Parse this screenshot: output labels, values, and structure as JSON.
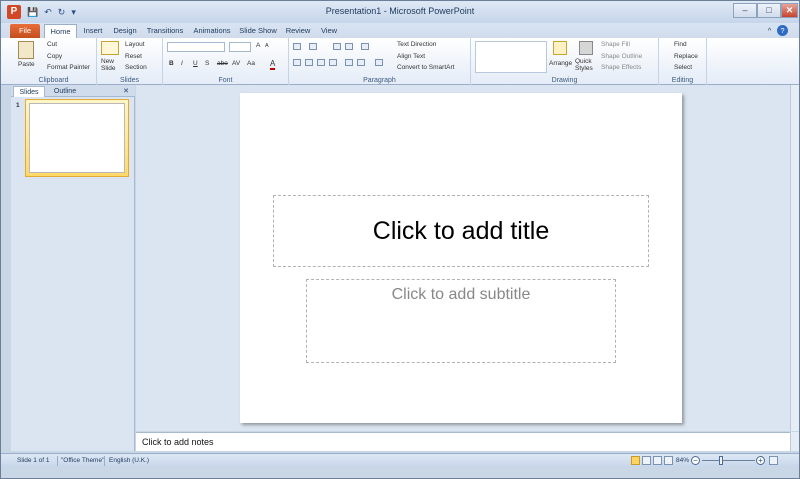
{
  "window": {
    "title": "Presentation1 - Microsoft PowerPoint",
    "min": "–",
    "max": "□",
    "close": "✕"
  },
  "qat": {
    "logo": "P",
    "save": "💾",
    "undo": "↶",
    "redo": "↻",
    "customize": "▾"
  },
  "tabs": [
    "File",
    "Home",
    "Insert",
    "Design",
    "Transitions",
    "Animations",
    "Slide Show",
    "Review",
    "View"
  ],
  "ribbon": {
    "clipboard": {
      "label": "Clipboard",
      "paste": "Paste",
      "cut": "Cut",
      "copy": "Copy",
      "format_painter": "Format Painter"
    },
    "slides": {
      "label": "Slides",
      "new_slide": "New Slide",
      "layout": "Layout",
      "reset": "Reset",
      "section": "Section"
    },
    "font": {
      "label": "Font",
      "bold": "B",
      "italic": "I",
      "underline": "U",
      "shadow": "S",
      "strike": "abe",
      "spacing": "AV",
      "case": "Aa",
      "color": "A",
      "grow": "A",
      "shrink": "A"
    },
    "paragraph": {
      "label": "Paragraph",
      "text_direction": "Text Direction",
      "align_text": "Align Text",
      "smartart": "Convert to SmartArt"
    },
    "drawing": {
      "label": "Drawing",
      "arrange": "Arrange",
      "quick_styles": "Quick Styles",
      "shape_fill": "Shape Fill",
      "shape_outline": "Shape Outline",
      "shape_effects": "Shape Effects"
    },
    "editing": {
      "label": "Editing",
      "find": "Find",
      "replace": "Replace",
      "select": "Select"
    }
  },
  "left_pane": {
    "tab_slides": "Slides",
    "tab_outline": "Outline",
    "close": "✕",
    "slide_number": "1"
  },
  "slide": {
    "title_placeholder": "Click to add title",
    "subtitle_placeholder": "Click to add subtitle"
  },
  "notes": {
    "placeholder": "Click to add notes"
  },
  "status": {
    "slide": "Slide 1 of 1",
    "theme": "\"Office Theme\"",
    "language": "English (U.K.)",
    "zoom": "84%",
    "zoom_out": "−",
    "zoom_in": "+"
  }
}
